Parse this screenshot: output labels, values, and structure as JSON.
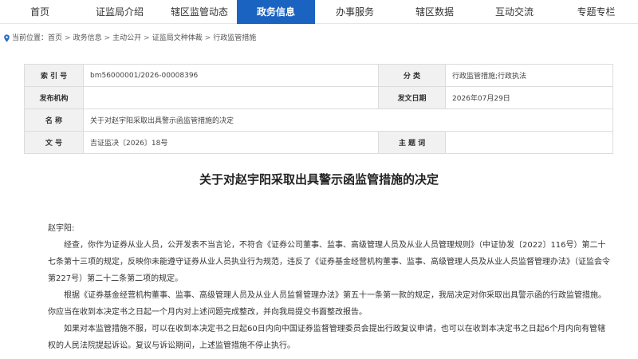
{
  "nav": {
    "items": [
      {
        "label": "首页"
      },
      {
        "label": "证监局介绍"
      },
      {
        "label": "辖区监管动态"
      },
      {
        "label": "政务信息"
      },
      {
        "label": "办事服务"
      },
      {
        "label": "辖区数据"
      },
      {
        "label": "互动交流"
      },
      {
        "label": "专题专栏"
      }
    ],
    "active_index": 3,
    "active_color": "#1b63c1"
  },
  "breadcrumb": {
    "prefix": "当前位置：",
    "items": [
      "首页",
      "政务信息",
      "主动公开",
      "证监局文种体裁",
      "行政监管措施"
    ],
    "icon": "location-pin-icon"
  },
  "meta": {
    "index_label": "索 引 号",
    "index_value": "bm56000001/2026-00008396",
    "category_label": "分 类",
    "category_value": "行政监管措施;行政执法",
    "publisher_label": "发布机构",
    "publisher_value": "",
    "date_label": "发文日期",
    "date_value": "2026年07月29日",
    "name_label": "名 称",
    "name_value": "关于对赵宇阳采取出具警示函监管措施的决定",
    "doc_no_label": "文 号",
    "doc_no_value": "吉证监决〔2026〕18号",
    "subject_label": "主 题 词",
    "subject_value": ""
  },
  "document": {
    "title": "关于对赵宇阳采取出具警示函监管措施的决定",
    "salutation": "赵宇阳:",
    "paragraphs": [
      "经查，你作为证券从业人员，公开发表不当言论，不符合《证券公司董事、监事、高级管理人员及从业人员管理规则》（中证协发〔2022〕116号）第二十七条第十三项的规定，反映你未能遵守证券从业人员执业行为规范，违反了《证券基金经营机构董事、监事、高级管理人员及从业人员监督管理办法》（证监会令第227号）第二十二条第二项的规定。",
      "根据《证券基金经营机构董事、监事、高级管理人员及从业人员监督管理办法》第五十一条第一款的规定，我局决定对你采取出具警示函的行政监管措施。你应当在收到本决定书之日起一个月内对上述问题完成整改，并向我局提交书面整改报告。",
      "如果对本监管措施不服，可以在收到本决定书之日起60日内向中国证券监督管理委员会提出行政复议申请，也可以在收到本决定书之日起6个月内向有管辖权的人民法院提起诉讼。复议与诉讼期间，上述监管措施不停止执行。"
    ]
  }
}
